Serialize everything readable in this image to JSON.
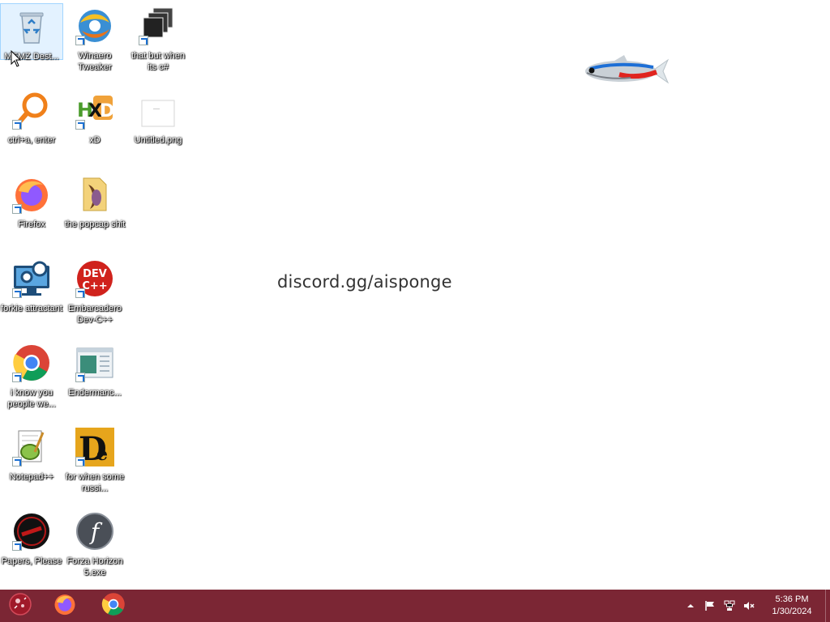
{
  "desktop": {
    "banner": "discord.gg/aisponge",
    "icons": [
      {
        "label": "MEMZ Dest...",
        "icon": "recycle-bin-icon"
      },
      {
        "label": "Winaero Tweaker",
        "icon": "winaero-tweaker-icon"
      },
      {
        "label": "that but when its c#",
        "icon": "stacked-windows-icon"
      },
      {
        "label": "ctrl+a, enter",
        "icon": "magnifier-icon"
      },
      {
        "label": "xD",
        "icon": "hxd-icon"
      },
      {
        "label": "Untitled.png",
        "icon": "image-file-icon"
      },
      {
        "label": "Firefox",
        "icon": "firefox-icon"
      },
      {
        "label": "the popcap shit",
        "icon": "folder-icon"
      },
      {
        "label": "forkie attractant",
        "icon": "computer-settings-icon"
      },
      {
        "label": "Embarcadero Dev-C++",
        "icon": "devcpp-icon"
      },
      {
        "label": "i know you people we...",
        "icon": "chrome-icon"
      },
      {
        "label": "Endermanc...",
        "icon": "window-app-icon"
      },
      {
        "label": "Notepad++",
        "icon": "notepadpp-icon"
      },
      {
        "label": "for when some russi...",
        "icon": "de-app-icon"
      },
      {
        "label": "Papers, Please",
        "icon": "papers-please-icon"
      },
      {
        "label": "Forza Horizon 5.exe",
        "icon": "flash-icon"
      }
    ]
  },
  "taskbar": {
    "color": "#7b2634",
    "pinned": [
      {
        "name": "start",
        "icon": "start-orb-icon"
      },
      {
        "name": "Firefox",
        "icon": "firefox-icon"
      },
      {
        "name": "Chrome",
        "icon": "chrome-icon"
      }
    ],
    "tray": {
      "time": "5:36 PM",
      "date": "1/30/2024",
      "icons": [
        "chevron-up-icon",
        "flag-icon",
        "network-icon",
        "volume-muted-icon"
      ]
    }
  }
}
